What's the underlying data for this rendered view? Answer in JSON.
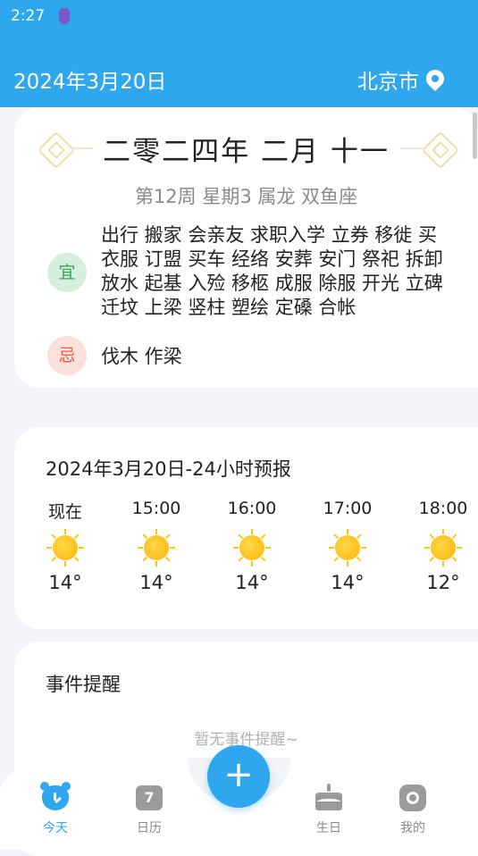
{
  "status_bar": {
    "time": "2:27"
  },
  "header": {
    "date": "2024年3月20日",
    "city": "北京市"
  },
  "almanac": {
    "lunar_date": "二零二四年 二月 十一",
    "subtitle": "第12周 星期3 属龙 双鱼座",
    "yi_label": "宜",
    "yi_items": "出行 搬家 会亲友 求职入学 立券 移徙 买衣服 订盟 买车 经络 安葬 安门 祭祀 拆卸 放水 起基 入殓 移柩 成服 除服 开光 立碑 迁坟 上梁 竖柱 塑绘 定磉 合帐",
    "ji_label": "忌",
    "ji_items": "伐木 作梁"
  },
  "weather": {
    "title": "2024年3月20日-24小时预报",
    "hours": [
      {
        "label": "现在",
        "icon": "sun-icon",
        "temp": "14°"
      },
      {
        "label": "15:00",
        "icon": "sun-icon",
        "temp": "14°"
      },
      {
        "label": "16:00",
        "icon": "sun-icon",
        "temp": "14°"
      },
      {
        "label": "17:00",
        "icon": "sun-icon",
        "temp": "14°"
      },
      {
        "label": "18:00",
        "icon": "sun-icon",
        "temp": "12°"
      }
    ]
  },
  "events": {
    "title": "事件提醒",
    "empty_text": "暂无事件提醒~"
  },
  "tabs": [
    {
      "label": "今天",
      "icon": "today-icon",
      "active": true
    },
    {
      "label": "日历",
      "icon": "calendar-icon",
      "badge": "7"
    },
    {
      "label": "生日",
      "icon": "cake-icon"
    },
    {
      "label": "我的",
      "icon": "profile-icon"
    }
  ],
  "fab": {
    "label": "+"
  },
  "colors": {
    "primary": "#2ea7ef",
    "yi": "#3aa35a",
    "ji": "#e35e4b"
  }
}
